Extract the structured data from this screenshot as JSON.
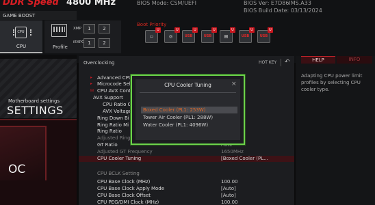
{
  "header": {
    "ddr_label": "DDR Speed",
    "ddr_value": "4800 MHz",
    "bios_mode": "BIOS Mode: CSM/UEFI",
    "bios_ver": "BIOS Ver: E7D86IMS.A33",
    "bios_date": "BIOS Build Date: 03/13/2024",
    "game_boost": "GAME BOOST"
  },
  "tiles": {
    "cpu_label": "CPU",
    "cpu_chip_text": "CPU",
    "profile_label": "Profile",
    "xmp_label": "XMP",
    "iexpo_label": "iEXPO",
    "btn_1": "1",
    "btn_2": "2"
  },
  "boot": {
    "title": "Boot Priority",
    "devices": [
      {
        "icon": "hdd-icon",
        "badge": "U"
      },
      {
        "icon": "disc-icon",
        "badge": "U"
      },
      {
        "icon": "usb-drive-icon",
        "text": "USB",
        "badge": "U"
      },
      {
        "icon": "usb-drive-icon",
        "text": "USB",
        "badge": "U"
      },
      {
        "icon": "network-icon",
        "badge": "U"
      },
      {
        "icon": "usb-drive-icon",
        "text": "USB",
        "badge": "U"
      },
      {
        "icon": "usb-drive-icon",
        "text": "USB",
        "badge": "U"
      }
    ]
  },
  "nav": {
    "mb_small": "Motherboard settings",
    "mb_big": "SETTINGS",
    "oc": "OC"
  },
  "main": {
    "title": "Overclocking",
    "hotkey": "HOT KEY",
    "hotkey_sep": "|",
    "rows": [
      {
        "name": "Advanced CPU",
        "value": ""
      },
      {
        "name": "Microcode Sel",
        "value": ""
      },
      {
        "name": "CPU AVX Contr",
        "value": ""
      },
      {
        "name": "AVX Support",
        "value": ""
      },
      {
        "name": "CPU Ratio O",
        "value": ""
      },
      {
        "name": "AVX Voltage",
        "value": ""
      },
      {
        "name": "Ring Down Bi",
        "value": ""
      },
      {
        "name": "Ring Ratio Mi",
        "value": ""
      },
      {
        "name": "Ring Ratio",
        "value": ""
      },
      {
        "name": "Adjusted Ring",
        "value": ""
      },
      {
        "name": "GT Ratio",
        "value": "Auto"
      },
      {
        "name": "Adjusted GT Frequency",
        "value": "1650MHz"
      },
      {
        "name": "CPU Cooler Tuning",
        "value": "[Boxed Cooler (PL..."
      },
      {
        "name": "CPU Base Clock (MHz)",
        "value": "100.00"
      },
      {
        "name": "CPU Base Clock Apply Mode",
        "value": "[Auto]"
      },
      {
        "name": "CPU Base Clock Offset",
        "value": "[Auto]"
      },
      {
        "name": "CPU PEG/DMI Clock (MHz)",
        "value": "100.00"
      }
    ],
    "section_bclk": "CPU  BCLK  Setting"
  },
  "help": {
    "tab_help": "HELP",
    "tab_info": "INFO",
    "text": "Adapting CPU power limit profiles by selecting CPU cooler type."
  },
  "modal": {
    "title": "CPU Cooler Tuning",
    "close": "×",
    "options": [
      "Boxed Cooler (PL1: 253W)",
      "Tower Air Cooler (PL1: 288W)",
      "Water Cooler (PL1: 4096W)"
    ],
    "selected_index": 0
  },
  "colors": {
    "accent_red": "#d81e24",
    "modal_border": "#6cd34a",
    "selected_option_text": "#e06a28"
  }
}
